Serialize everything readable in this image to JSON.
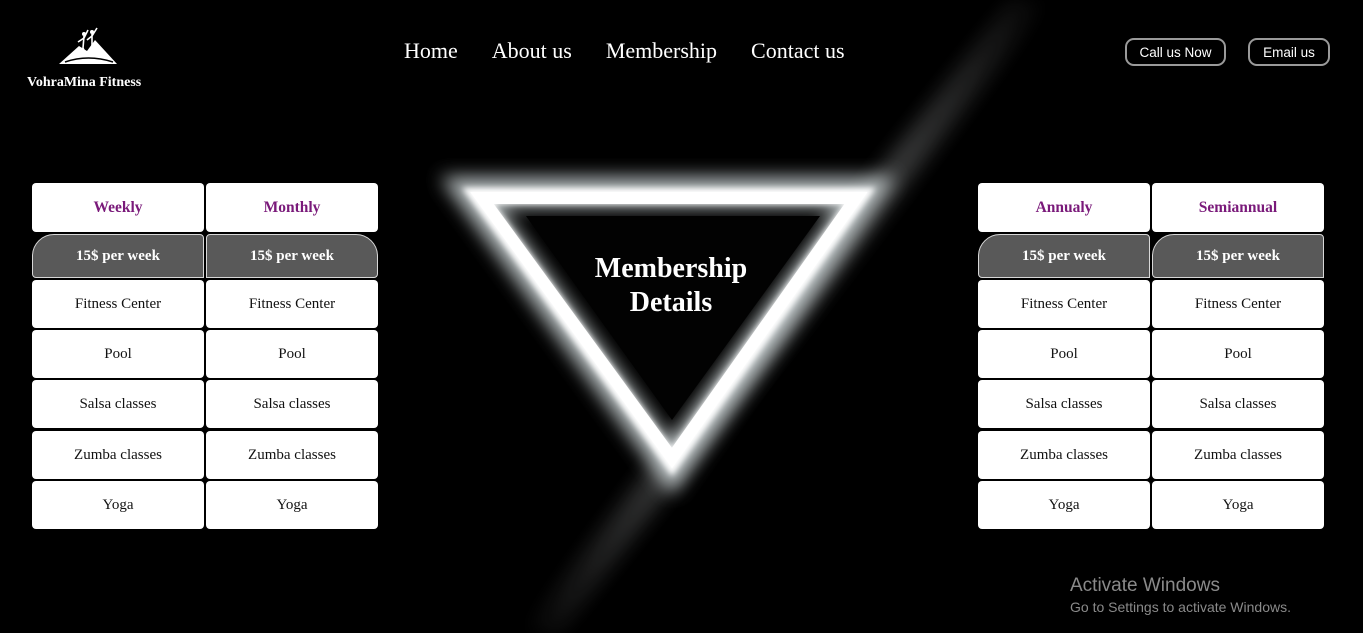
{
  "brand": {
    "name": "VohraMina Fitness",
    "logo_icon": "mountain-climbers-icon"
  },
  "nav": {
    "items": [
      "Home",
      "About us",
      "Membership",
      "Contact us"
    ]
  },
  "header_buttons": {
    "call": "Call us Now",
    "email": "Email us"
  },
  "hero": {
    "title_line1": "Membership",
    "title_line2": "Details"
  },
  "plans": [
    {
      "name": "Weekly",
      "price": "15$ per week",
      "features": [
        "Fitness Center",
        "Pool",
        "Salsa classes",
        "Zumba classes",
        "Yoga"
      ]
    },
    {
      "name": "Monthly",
      "price": "15$ per week",
      "features": [
        "Fitness Center",
        "Pool",
        "Salsa classes",
        "Zumba classes",
        "Yoga"
      ]
    },
    {
      "name": "Annualy",
      "price": "15$ per week",
      "features": [
        "Fitness Center",
        "Pool",
        "Salsa classes",
        "Zumba classes",
        "Yoga"
      ]
    },
    {
      "name": "Semiannual",
      "price": "15$ per week",
      "features": [
        "Fitness Center",
        "Pool",
        "Salsa classes",
        "Zumba classes",
        "Yoga"
      ]
    }
  ],
  "watermark": {
    "line1": "Activate Windows",
    "line2": "Go to Settings to activate Windows."
  },
  "colors": {
    "background": "#000000",
    "plan_title": "#7a1a7a",
    "price_bg": "#595959",
    "cell_bg": "#ffffff"
  }
}
